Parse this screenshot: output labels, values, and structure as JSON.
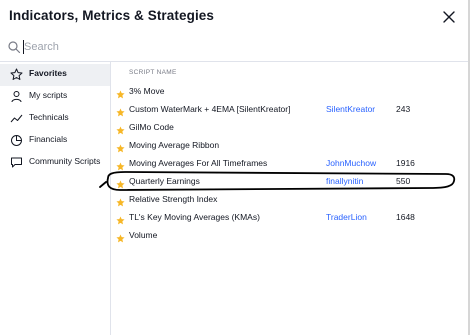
{
  "dialog": {
    "title": "Indicators, Metrics & Strategies"
  },
  "search": {
    "placeholder": "Search"
  },
  "sidebar": {
    "items": [
      {
        "label": "Favorites",
        "icon": "star-outline-icon",
        "active": true
      },
      {
        "label": "My scripts",
        "icon": "user-icon",
        "active": false
      },
      {
        "label": "Technicals",
        "icon": "chart-line-icon",
        "active": false
      },
      {
        "label": "Financials",
        "icon": "pie-chart-icon",
        "active": false
      },
      {
        "label": "Community Scripts",
        "icon": "community-icon",
        "active": false
      }
    ]
  },
  "list": {
    "column_header": "SCRIPT NAME",
    "rows": [
      {
        "name": "3% Move",
        "author": "",
        "count": ""
      },
      {
        "name": "Custom WaterMark + 4EMA [SilentKreator]",
        "author": "SilentKreator",
        "count": "243"
      },
      {
        "name": "GilMo Code",
        "author": "",
        "count": ""
      },
      {
        "name": "Moving Average Ribbon",
        "author": "",
        "count": ""
      },
      {
        "name": "Moving Averages For All Timeframes",
        "author": "JohnMuchow",
        "count": "1916"
      },
      {
        "name": "Quarterly Earnings",
        "author": "finallynitin",
        "count": "550"
      },
      {
        "name": "Relative Strength Index",
        "author": "",
        "count": ""
      },
      {
        "name": "TL's Key Moving Averages (KMAs)",
        "author": "TraderLion",
        "count": "1648"
      },
      {
        "name": "Volume",
        "author": "",
        "count": ""
      }
    ]
  },
  "colors": {
    "star": "#f7b727",
    "link": "#2962ff",
    "active_bg": "#eef0f3"
  }
}
